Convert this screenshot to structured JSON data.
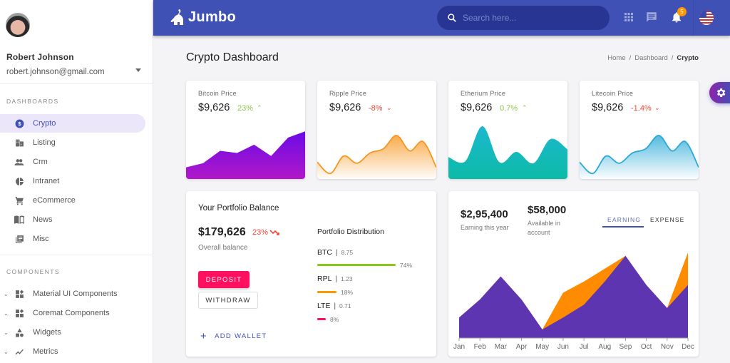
{
  "user": {
    "name": "Robert Johnson",
    "email": "robert.johnson@gmail.com"
  },
  "sidebar": {
    "sections": [
      {
        "title": "DASHBOARDS"
      },
      {
        "title": "COMPONENTS"
      }
    ],
    "dashboards": [
      {
        "label": "Crypto",
        "icon": "dollar-circle-icon",
        "active": true
      },
      {
        "label": "Listing",
        "icon": "building-icon"
      },
      {
        "label": "Crm",
        "icon": "people-icon"
      },
      {
        "label": "Intranet",
        "icon": "pie-icon"
      },
      {
        "label": "eCommerce",
        "icon": "cart-icon"
      },
      {
        "label": "News",
        "icon": "book-icon"
      },
      {
        "label": "Misc",
        "icon": "library-icon"
      }
    ],
    "components": [
      {
        "label": "Material UI Components",
        "icon": "widgets-icon"
      },
      {
        "label": "Coremat Components",
        "icon": "widgets-icon"
      },
      {
        "label": "Widgets",
        "icon": "shapes-icon"
      },
      {
        "label": "Metrics",
        "icon": "trend-icon"
      }
    ]
  },
  "header": {
    "brand": "Jumbo",
    "search_placeholder": "Search here...",
    "notification_count": "5",
    "accent": "#3f51b5"
  },
  "page": {
    "title": "Crypto Dashboard",
    "breadcrumb": [
      "Home",
      "Dashboard",
      "Crypto"
    ]
  },
  "price_cards": [
    {
      "title": "Bitcoin Price",
      "value": "$9,626",
      "change": "23%",
      "direction": "up",
      "color": "#7c16e8",
      "series": [
        20,
        28,
        52,
        48,
        64,
        42,
        78,
        90
      ]
    },
    {
      "title": "Ripple Price",
      "value": "$9,626",
      "change": "-8%",
      "direction": "down",
      "color": "#f7961e",
      "series": [
        30,
        8,
        42,
        28,
        48,
        56,
        82,
        52,
        70,
        20
      ]
    },
    {
      "title": "Etherium Price",
      "value": "$9,626",
      "change": "0.7%",
      "direction": "up",
      "color": "#18b4c2",
      "series": [
        40,
        32,
        100,
        30,
        50,
        28,
        75,
        55
      ]
    },
    {
      "title": "Litecoin Price",
      "value": "$9,626",
      "change": "-1.4%",
      "direction": "down",
      "color": "#2aa9d6",
      "series": [
        30,
        8,
        42,
        28,
        48,
        56,
        82,
        52,
        70,
        20
      ]
    }
  ],
  "portfolio": {
    "title": "Your Portfolio Balance",
    "balance": "$179,626",
    "change": "23%",
    "subtitle": "Overall balance",
    "deposit_label": "DEPOSIT",
    "withdraw_label": "WITHDRAW",
    "add_wallet_label": "ADD WALLET",
    "distribution_title": "Portfolio Distribution",
    "distribution": [
      {
        "coin": "BTC",
        "amount": "8.75",
        "percent": 74,
        "percent_label": "74%",
        "color": "#8bc918"
      },
      {
        "coin": "RPL",
        "amount": "1.23",
        "percent": 18,
        "percent_label": "18%",
        "color": "#ff9800"
      },
      {
        "coin": "LTE",
        "amount": "0.71",
        "percent": 8,
        "percent_label": "8%",
        "color": "#ff0f5f"
      }
    ]
  },
  "earning": {
    "earning_value": "$2,95,400",
    "earning_label": "Earning this year",
    "available_value": "$58,000",
    "available_label": "Available in account",
    "tabs": [
      {
        "label": "EARNING",
        "active": true
      },
      {
        "label": "EXPENSE",
        "active": false
      }
    ]
  },
  "chart_data": {
    "type": "area",
    "title": "",
    "categories": [
      "Jan",
      "Feb",
      "Mar",
      "Apr",
      "May",
      "Jun",
      "Jul",
      "Aug",
      "Sep",
      "Oct",
      "Nov",
      "Dec"
    ],
    "series": [
      {
        "name": "Expense",
        "color": "#ff8c00",
        "values": [
          24,
          45,
          72,
          45,
          10,
          53,
          66,
          81,
          96,
          62,
          35,
          100
        ]
      },
      {
        "name": "Earning",
        "color": "#5e35b1",
        "values": [
          24,
          45,
          72,
          45,
          10,
          24,
          39,
          66,
          96,
          62,
          35,
          62
        ]
      }
    ],
    "ylim": [
      0,
      100
    ],
    "grid": false,
    "legend": "none",
    "xlabel": "",
    "ylabel": ""
  }
}
